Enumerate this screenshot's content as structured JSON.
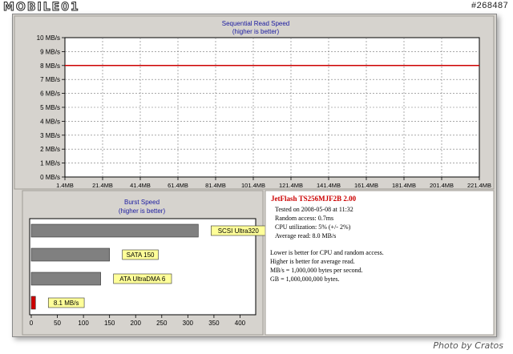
{
  "watermark": {
    "brand": "MOBILE01",
    "photo_id": "#268487",
    "credit": "Photo by Cratos"
  },
  "chart_data": [
    {
      "type": "line",
      "title": "Sequential Read Speed",
      "subtitle": "(higher is better)",
      "x_ticks": [
        "1.4MB",
        "21.4MB",
        "41.4MB",
        "61.4MB",
        "81.4MB",
        "101.4MB",
        "121.4MB",
        "141.4MB",
        "161.4MB",
        "181.4MB",
        "201.4MB",
        "221.4MB"
      ],
      "y_ticks": [
        "0 MB/s",
        "1 MB/s",
        "2 MB/s",
        "3 MB/s",
        "4 MB/s",
        "5 MB/s",
        "6 MB/s",
        "7 MB/s",
        "8 MB/s",
        "9 MB/s",
        "10 MB/s"
      ],
      "ylim": [
        0,
        10
      ],
      "series": [
        {
          "x": [
            1.4,
            221.4
          ],
          "y": [
            8.0,
            8.0
          ],
          "color": "#cc0000"
        }
      ],
      "grid": true
    },
    {
      "type": "bar",
      "orientation": "horizontal",
      "title": "Burst Speed",
      "subtitle": "(higher is better)",
      "categories": [
        "SCSI Ultra320",
        "SATA 150",
        "ATA UltraDMA 6",
        "8.1 MB/s"
      ],
      "values": [
        320,
        150,
        133,
        8.1
      ],
      "colors": [
        "#808080",
        "#808080",
        "#808080",
        "#cc0000"
      ],
      "x_ticks": [
        "0",
        "50",
        "100",
        "150",
        "200",
        "250",
        "300",
        "350",
        "400"
      ],
      "xlim": [
        0,
        430
      ]
    }
  ],
  "info": {
    "title": "JetFlash TS256MJF2B 2.00",
    "stats": [
      "Tested on 2008-05-08 at 11:32",
      "Random access: 0.7ms",
      "CPU utilization: 5% (+/- 2%)",
      "Average read: 8.0 MB/s"
    ],
    "notes": [
      "Lower is better for CPU and random access.",
      "Higher is better for average read.",
      "MB/s = 1,000,000 bytes per second.",
      "GB = 1,000,000,000 bytes."
    ]
  }
}
